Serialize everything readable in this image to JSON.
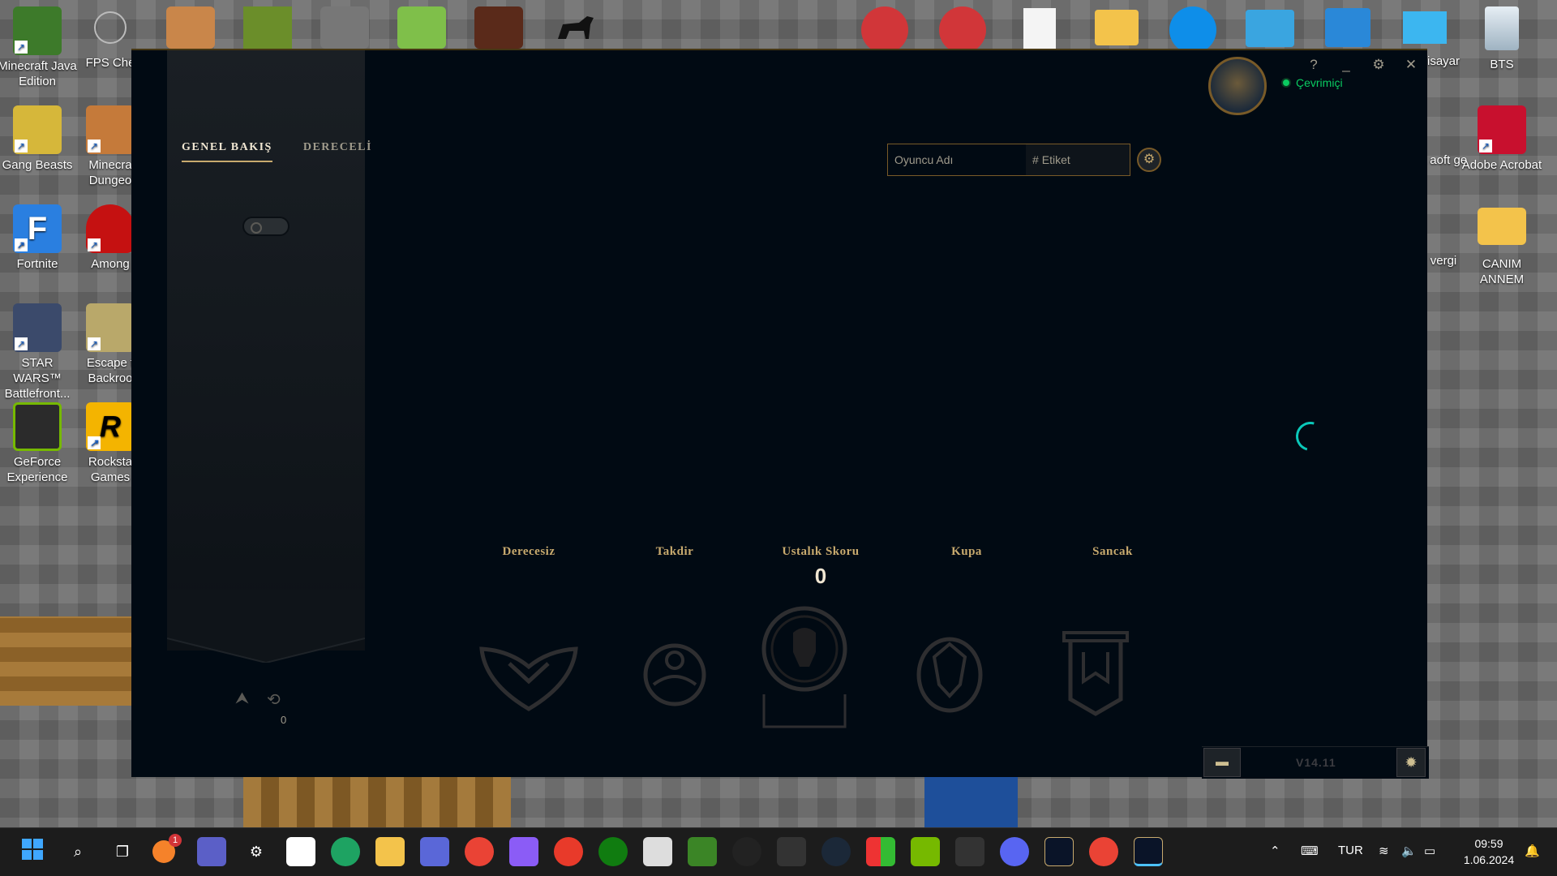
{
  "desktop": {
    "left_icons": [
      {
        "label": "Minecraft Java Edition",
        "color": "#3d7a2a"
      },
      {
        "label": "FPS Che",
        "color": "#9aa0a6"
      },
      {
        "label": "Gang Beasts",
        "color": "#d6b73a"
      },
      {
        "label": "Minecra Dungeo",
        "color": "#c57a3a"
      },
      {
        "label": "Fortnite",
        "color": "#2a7fe0"
      },
      {
        "label": "Among",
        "color": "#c51111"
      },
      {
        "label": "STAR WARS™ Battlefront...",
        "color": "#3b4a6b"
      },
      {
        "label": "Escape t Backroo",
        "color": "#b9a86a"
      },
      {
        "label": "GeForce Experience",
        "color": "#2b2b2b"
      },
      {
        "label": "Rocksta Games",
        "color": "#f4b400"
      }
    ],
    "right_icons": [
      {
        "label": "isayar",
        "color": "#2aa9e0"
      },
      {
        "label": "BTS",
        "color": "#cfd8e0"
      },
      {
        "label": "a aoft ge",
        "color": "#1ea362"
      },
      {
        "label": "Adobe Acrobat",
        "color": "#c8102e"
      },
      {
        "label": "vergi",
        "color": "#f3c34b"
      },
      {
        "label": "CANIM ANNEM",
        "color": "#f3c34b"
      }
    ]
  },
  "client": {
    "tabs": [
      {
        "label": "GENEL BAKIŞ",
        "active": true
      },
      {
        "label": "DERECELİ",
        "active": false
      }
    ],
    "status": "Çevrimiçi",
    "window_controls": {
      "help": "?",
      "minimize": "_",
      "settings": "⚙",
      "close": "✕"
    },
    "search": {
      "placeholder": "Oyuncu Adı",
      "tag_label": "Etiket",
      "tag_icon": "#"
    },
    "left_count": "0",
    "stats": [
      {
        "label": "Derecesiz",
        "value": ""
      },
      {
        "label": "Takdir",
        "value": ""
      },
      {
        "label": "Ustalık Skoru",
        "value": "0"
      },
      {
        "label": "Kupa",
        "value": ""
      },
      {
        "label": "Sancak",
        "value": ""
      }
    ],
    "version": "V14.11",
    "colors": {
      "gold": "#c8aa6e",
      "online": "#0acb61",
      "spinner": "#0ac8b9",
      "bg": "#010a13"
    }
  },
  "taskbar": {
    "language": "TUR",
    "time": "09:59",
    "date": "1.06.2024",
    "notification_badge": "1"
  }
}
